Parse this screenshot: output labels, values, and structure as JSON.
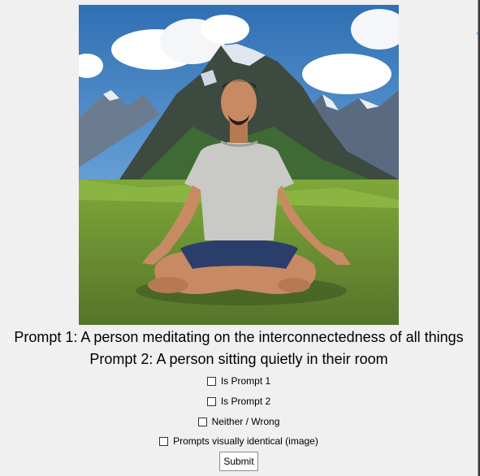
{
  "prompts": {
    "prompt1": "Prompt 1: A person meditating on the interconnectedness of all things",
    "prompt2": "Prompt 2: A person sitting quietly in their room"
  },
  "options": [
    {
      "label": "Is Prompt 1",
      "checked": false
    },
    {
      "label": "Is Prompt 2",
      "checked": false
    },
    {
      "label": "Neither / Wrong",
      "checked": false
    },
    {
      "label": "Prompts visually identical (image)",
      "checked": false
    }
  ],
  "submit_label": "Submit",
  "image": {
    "subject": "man meditating cross-legged on grassy meadow with snowy mountains and blue sky"
  }
}
